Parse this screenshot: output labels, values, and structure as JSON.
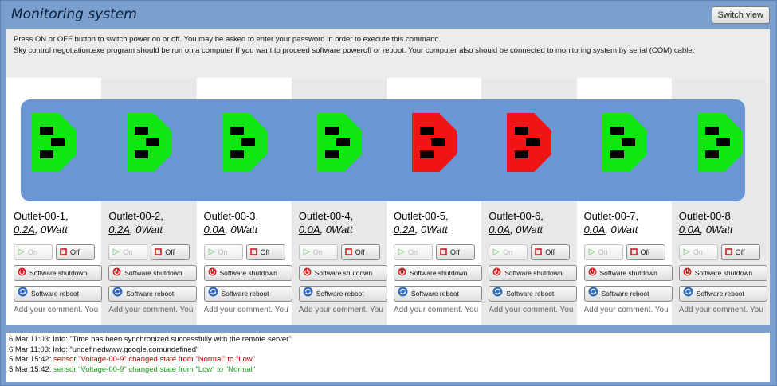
{
  "app": {
    "title": "Monitoring system",
    "switch_view_label": "Switch view"
  },
  "instructions": {
    "line1": "Press ON or OFF button to switch power on or off. You may be asked to enter your password in order to execute this command.",
    "line2": "Sky control negotiation.exe program should be run on a computer If you want to proceed software poweroff or reboot. Your computer also should be connected to monitoring system by serial (COM) cable."
  },
  "colors": {
    "socket_on": "#12e612",
    "socket_off": "#f01414",
    "strip": "#6b96d4"
  },
  "outlets": [
    {
      "name": "Outlet-00-1,",
      "current": "0.2A",
      "power": ", 0Watt",
      "state": "on",
      "on_label": "On",
      "off_label": "Off",
      "shutdown_label": "Software shutdown",
      "reboot_label": "Software reboot",
      "comment": "Add your comment. You"
    },
    {
      "name": "Outlet-00-2,",
      "current": "0.2A",
      "power": ", 0Watt",
      "state": "on",
      "on_label": "On",
      "off_label": "Off",
      "shutdown_label": "Software shutdown",
      "reboot_label": "Software reboot",
      "comment": "Add your comment. You"
    },
    {
      "name": "Outlet-00-3,",
      "current": "0.0A",
      "power": ", 0Watt",
      "state": "on",
      "on_label": "On",
      "off_label": "Off",
      "shutdown_label": "Software shutdown",
      "reboot_label": "Software reboot",
      "comment": "Add your comment. You"
    },
    {
      "name": "Outlet-00-4,",
      "current": "0.0A",
      "power": ", 0Watt",
      "state": "on",
      "on_label": "On",
      "off_label": "Off",
      "shutdown_label": "Software shutdown",
      "reboot_label": "Software reboot",
      "comment": "Add your comment. You"
    },
    {
      "name": "Outlet-00-5,",
      "current": "0.2A",
      "power": ", 0Watt",
      "state": "off",
      "on_label": "On",
      "off_label": "Off",
      "shutdown_label": "Software shutdown",
      "reboot_label": "Software reboot",
      "comment": "Add your comment. You"
    },
    {
      "name": "Outlet-00-6,",
      "current": "0.0A",
      "power": ", 0Watt",
      "state": "off",
      "on_label": "On",
      "off_label": "Off",
      "shutdown_label": "Software shutdown",
      "reboot_label": "Software reboot",
      "comment": "Add your comment. You"
    },
    {
      "name": "Outlet-00-7,",
      "current": "0.0A",
      "power": ", 0Watt",
      "state": "on",
      "on_label": "On",
      "off_label": "Off",
      "shutdown_label": "Software shutdown",
      "reboot_label": "Software reboot",
      "comment": "Add your comment. You"
    },
    {
      "name": "Outlet-00-8,",
      "current": "0.0A",
      "power": ", 0Watt",
      "state": "on",
      "on_label": "On",
      "off_label": "Off",
      "shutdown_label": "Software shutdown",
      "reboot_label": "Software reboot",
      "comment": "Add your comment. You"
    }
  ],
  "log": [
    {
      "time": "6 Mar 11:03:",
      "text": " Info: \"Time has been synchronized successfully with the remote server\"",
      "level": "info"
    },
    {
      "time": "6 Mar 11:03:",
      "text": " Info: \"undefinedwww.google.comundefined\"",
      "level": "info"
    },
    {
      "time": "5 Mar 15:42:",
      "text": " sensor \"Voltage-00-9\" changed state from \"Normal\" to \"Low\"",
      "level": "alert"
    },
    {
      "time": "5 Mar 15:42:",
      "text": " sensor \"Voltage-00-9\" changed state from \"Low\" to \"Normal\"",
      "level": "ok"
    }
  ]
}
